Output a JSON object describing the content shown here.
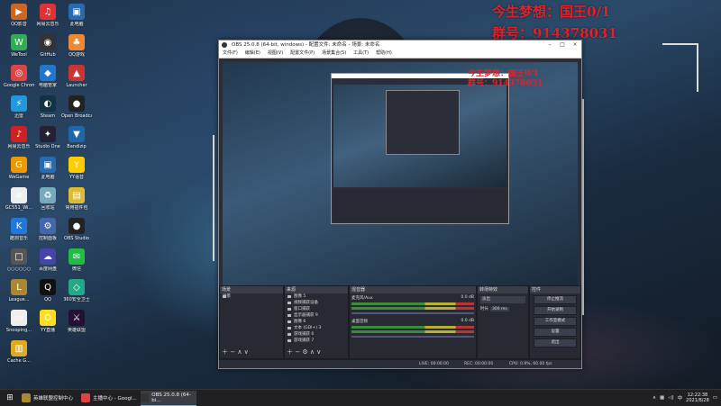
{
  "overlay": {
    "line1": "今生梦想：国王0/1",
    "line2": "群号：914378031",
    "small1": "今生梦想：国王0/1",
    "small2": "群号：914378031"
  },
  "desktop_icons": [
    {
      "label": "QQ影音",
      "color": "#c62",
      "glyph": "▶"
    },
    {
      "label": "网易云音乐",
      "color": "#d33",
      "glyph": "♫"
    },
    {
      "label": "此电脑",
      "color": "#2a6bb0",
      "glyph": "▣"
    },
    {
      "label": "WeTool",
      "color": "#3a5",
      "glyph": "W"
    },
    {
      "label": "GitHub",
      "color": "#333",
      "glyph": "◉"
    },
    {
      "label": "QQ游戏",
      "color": "#e83",
      "glyph": "♣"
    },
    {
      "label": "Google Chrome",
      "color": "#d44",
      "glyph": "◎"
    },
    {
      "label": "电脑管家",
      "color": "#27c",
      "glyph": "◆"
    },
    {
      "label": "Launcher",
      "color": "#c33",
      "glyph": "▲"
    },
    {
      "label": "迅雷",
      "color": "#29d",
      "glyph": "⚡"
    },
    {
      "label": "Steam",
      "color": "#134",
      "glyph": "◐"
    },
    {
      "label": "Open Broadcast",
      "color": "#222",
      "glyph": "●"
    },
    {
      "label": "网易云音乐",
      "color": "#c22",
      "glyph": "♪"
    },
    {
      "label": "Studio One",
      "color": "#223",
      "glyph": "✦"
    },
    {
      "label": "Bandizip",
      "color": "#26a",
      "glyph": "▼"
    },
    {
      "label": "WeGame",
      "color": "#e90",
      "glyph": "G"
    },
    {
      "label": "此电脑",
      "color": "#2a6bb0",
      "glyph": "▣"
    },
    {
      "label": "YY语音",
      "color": "#fc0",
      "glyph": "Y"
    },
    {
      "label": "GC551_Wi...",
      "color": "#eee",
      "glyph": "≡"
    },
    {
      "label": "回收站",
      "color": "#7ab",
      "glyph": "♻"
    },
    {
      "label": "常用插件包",
      "color": "#db3",
      "glyph": "▤"
    },
    {
      "label": "酷狗音乐",
      "color": "#27d",
      "glyph": "K"
    },
    {
      "label": "控制面板",
      "color": "#46a",
      "glyph": "⚙"
    },
    {
      "label": "OBS Studio",
      "color": "#222",
      "glyph": "●"
    },
    {
      "label": "○○○○○○",
      "color": "#555",
      "glyph": "□"
    },
    {
      "label": "百度网盘",
      "color": "#44a",
      "glyph": "☁"
    },
    {
      "label": "微信",
      "color": "#2b4",
      "glyph": "✉"
    },
    {
      "label": "League...",
      "color": "#a83",
      "glyph": "L"
    },
    {
      "label": "QQ",
      "color": "#111",
      "glyph": "Q"
    },
    {
      "label": "360安全卫士",
      "color": "#2a8",
      "glyph": "◇"
    },
    {
      "label": "Snooping...",
      "color": "#eee",
      "glyph": "▭"
    },
    {
      "label": "YY直播",
      "color": "#fd2",
      "glyph": "O"
    },
    {
      "label": "英雄联盟",
      "color": "#213",
      "glyph": "⚔"
    },
    {
      "label": "Cache G...",
      "color": "#da2",
      "glyph": "▥"
    }
  ],
  "obs": {
    "title": "OBS 25.0.8 (64-bit, windows) - 配置文件: 未命名 - 场景: 未命名",
    "menu": [
      "文件(F)",
      "编辑(E)",
      "视图(V)",
      "配置文件(P)",
      "场景集合(S)",
      "工具(T)",
      "帮助(H)"
    ],
    "docks": {
      "scenes_title": "场景",
      "scene_item": "场景",
      "sources_title": "来源",
      "sources": [
        "图像 5",
        "视频捕获设备",
        "窗口捕获",
        "显示器捕获 9",
        "图像 6",
        "文本 (GDI+) 3",
        "游戏捕获 6",
        "游戏捕获 7"
      ],
      "mixer_title": "混音器",
      "mixer_ch1": "麦克风/Aux",
      "mixer_ch2": "桌面音频",
      "mixer_db": "0.0 dB",
      "transitions_title": "转场特效",
      "transition_value": "淡出",
      "duration_label": "时长",
      "duration_value": "300 ms",
      "controls_title": "控件",
      "controls": [
        "停止推流",
        "开始录制",
        "工作室模式",
        "设置",
        "退出"
      ]
    },
    "status": {
      "live": "LIVE: 00:00:00",
      "rec": "REC: 00:00:00",
      "cpu": "CPU: 0.9%, 60.00 fps"
    }
  },
  "taskbar": {
    "items": [
      {
        "label": "英雄联盟控制中心",
        "color": "#a83"
      },
      {
        "label": "主播中心 - Googl...",
        "color": "#d44"
      },
      {
        "label": "OBS 25.0.8 (64-bi...",
        "color": "#333"
      }
    ],
    "tray_lang": "中",
    "time": "12:22:38",
    "date": "2021/8/28"
  }
}
